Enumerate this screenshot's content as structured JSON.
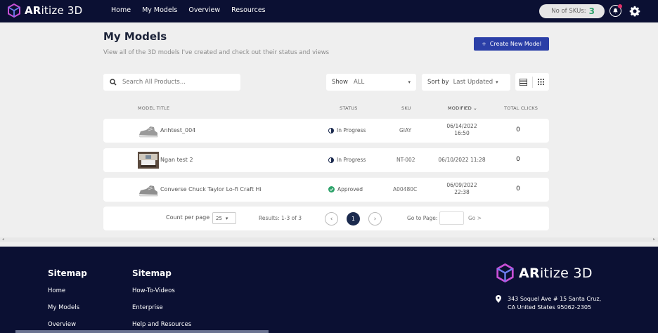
{
  "header": {
    "brand_bold": "AR",
    "brand_rest": "itize 3D",
    "nav": [
      "Home",
      "My Models",
      "Overview",
      "Resources"
    ],
    "sku_label": "No of SKUs:",
    "sku_count": "3"
  },
  "page": {
    "title": "My Models",
    "subtitle": "View all of the 3D models I've created and check out their status and views",
    "create_button": "Create New Model"
  },
  "filters": {
    "search_placeholder": "Search All Products...",
    "show_label": "Show",
    "show_value": "ALL",
    "sort_label": "Sort by",
    "sort_value": "Last Updated"
  },
  "table": {
    "headers": {
      "title": "MODEL TITLE",
      "status": "STATUS",
      "sku": "SKU",
      "modified": "MODIFIED",
      "clicks": "TOTAL CLICKS"
    },
    "rows": [
      {
        "title": "Anhtest_004",
        "status": "In Progress",
        "sku": "GIAY",
        "modified_1": "06/14/2022",
        "modified_2": "16:50",
        "clicks": "0"
      },
      {
        "title": "Ngan test 2",
        "status": "In Progress",
        "sku": "NT-002",
        "modified_1": "06/10/2022 11:28",
        "modified_2": "",
        "clicks": "0"
      },
      {
        "title": "Converse Chuck Taylor Lo-fi Craft Hi",
        "status": "Approved",
        "sku": "A00480C",
        "modified_1": "06/09/2022",
        "modified_2": "22:38",
        "clicks": "0"
      }
    ]
  },
  "pagination": {
    "count_label": "Count per page",
    "count_value": "25",
    "results": "Results: 1-3 of 3",
    "current_page": "1",
    "goto_label": "Go to Page:",
    "go_label": "Go >"
  },
  "footer": {
    "col1_heading": "Sitemap",
    "col1_links": [
      "Home",
      "My Models",
      "Overview"
    ],
    "col2_heading": "Sitemap",
    "col2_links": [
      "How-To-Videos",
      "Enterprise",
      "Help and Resources"
    ],
    "brand_bold": "AR",
    "brand_rest": "itize 3D",
    "address_1": "343 Soquel Ave # 15 Santa Cruz,",
    "address_2": "CA United States 95062-2305"
  },
  "colors": {
    "navy": "#0b1033",
    "accent_blue": "#2b3fa7",
    "approved_green": "#2ea36b"
  }
}
